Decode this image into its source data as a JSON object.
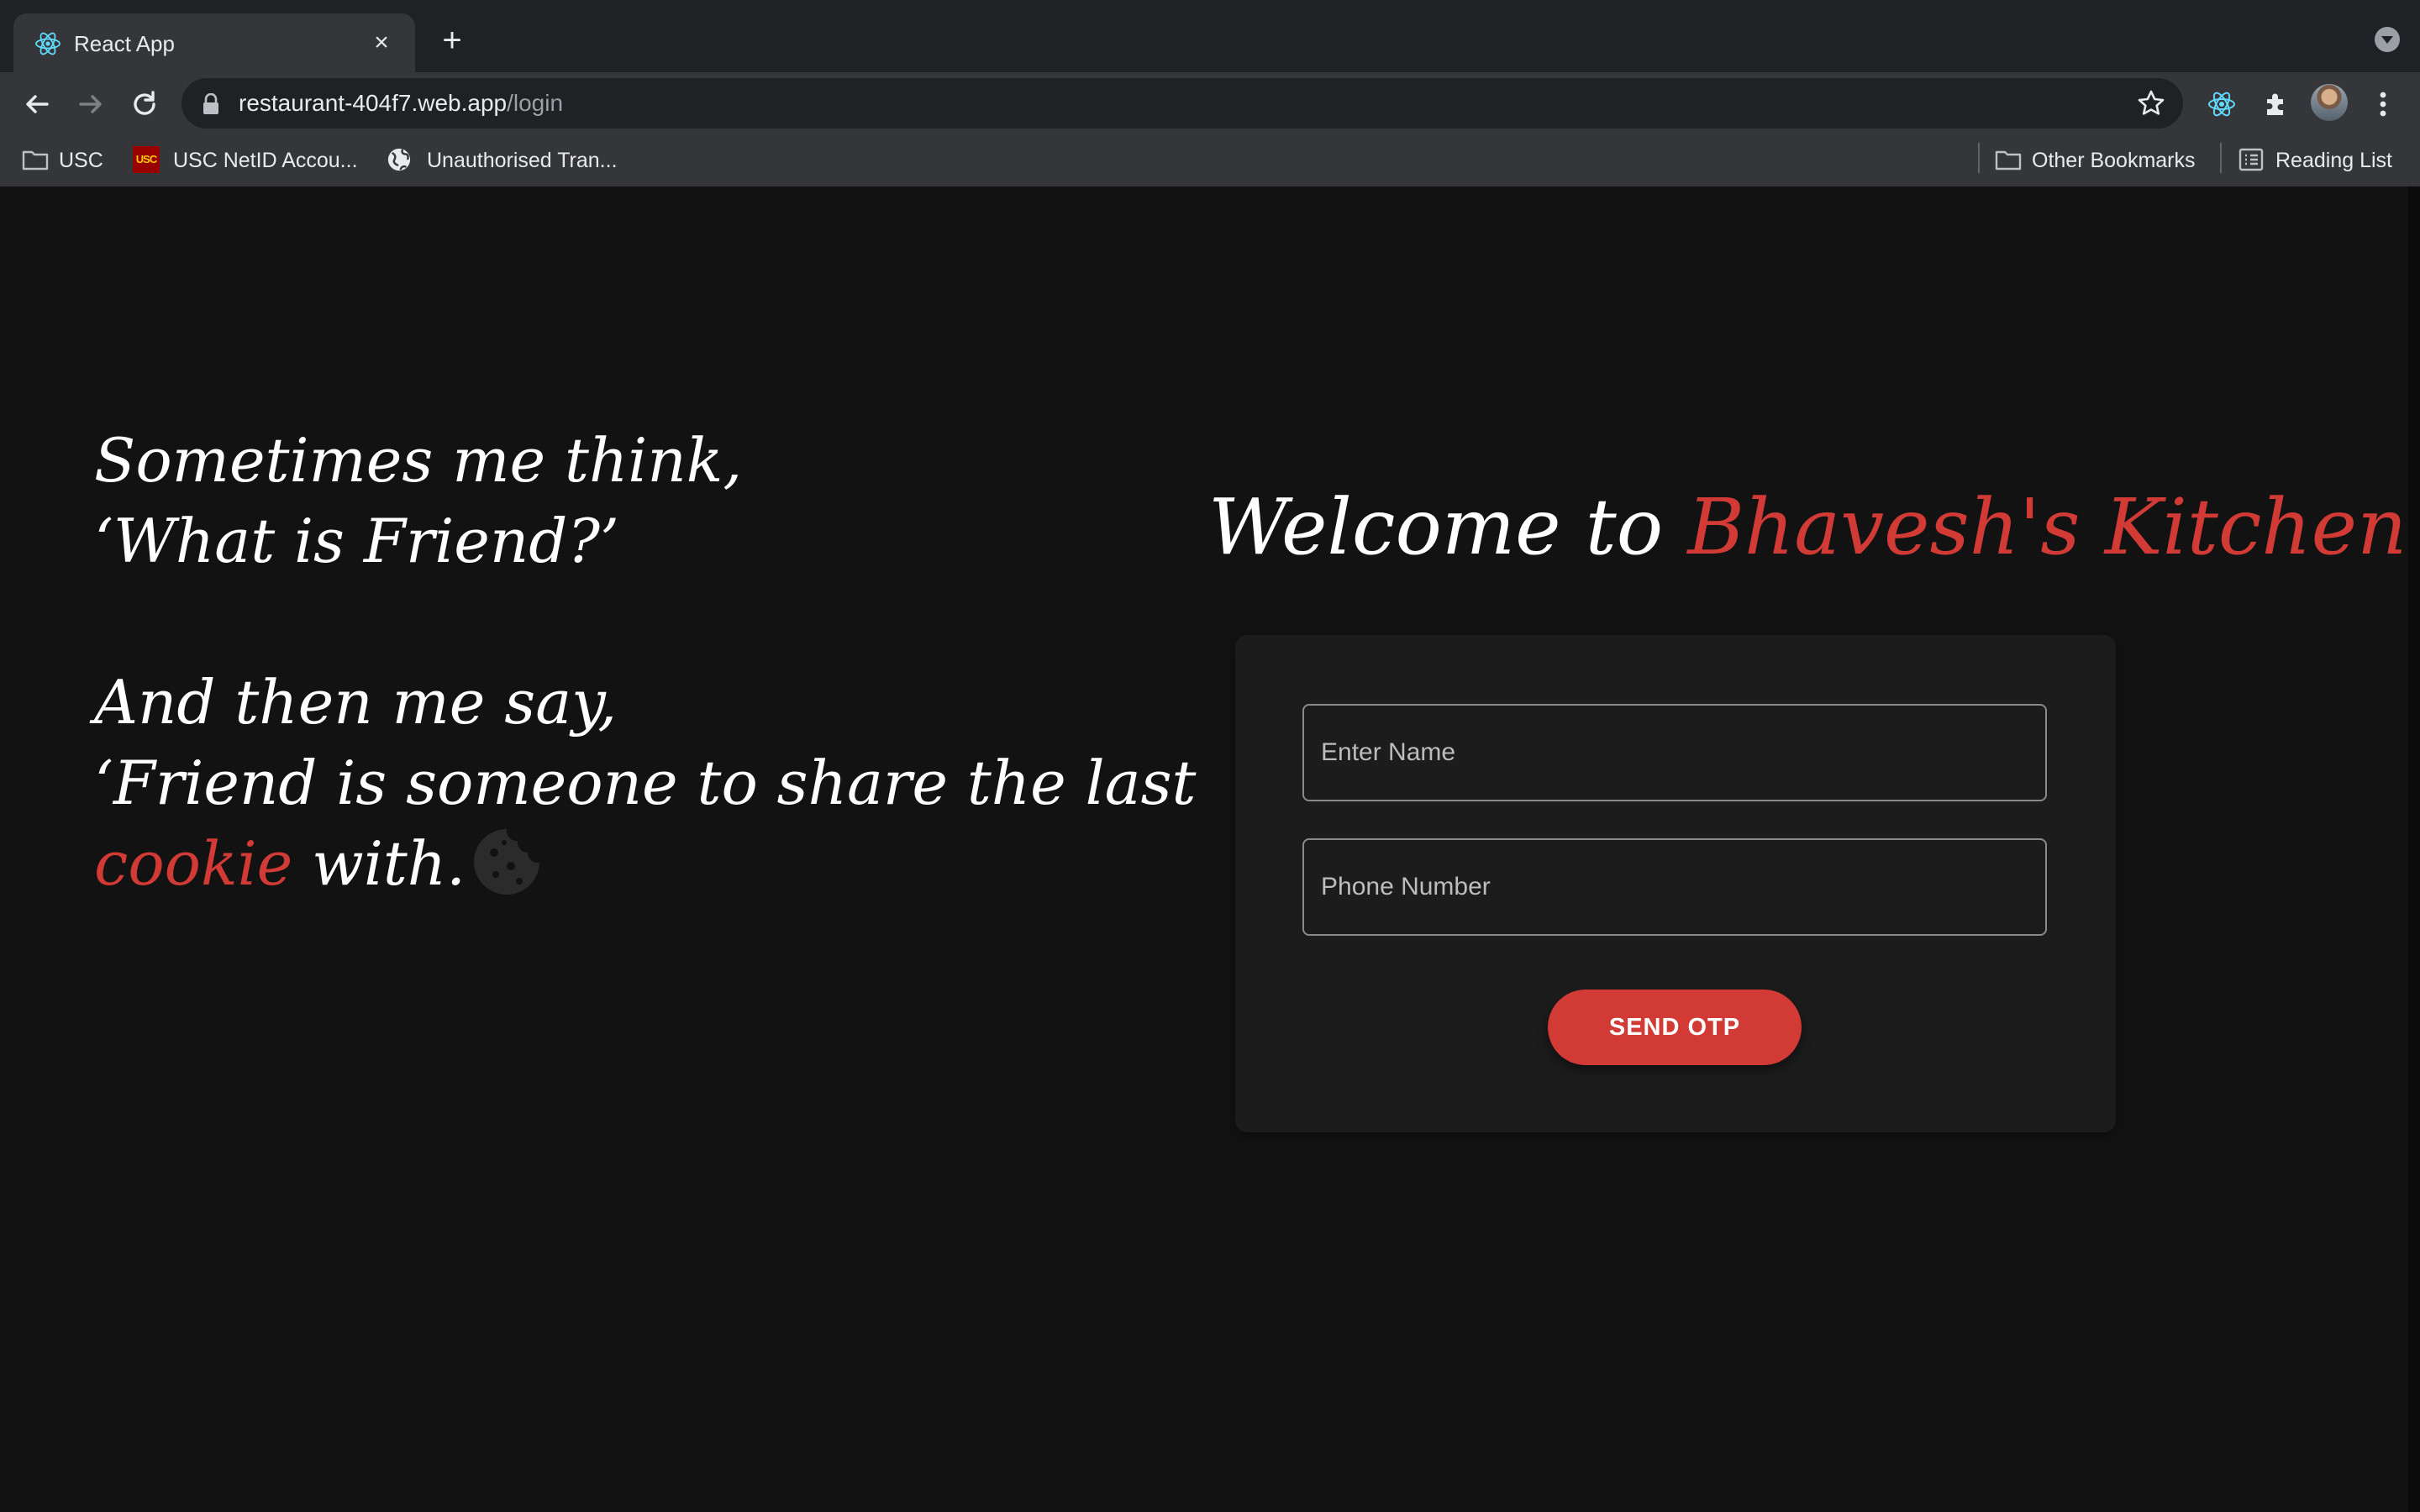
{
  "browser": {
    "tab_title": "React App",
    "tab_close_glyph": "×",
    "new_tab_glyph": "+",
    "url_host": "restaurant-404f7.web.app",
    "url_path": "/login",
    "bookmarks": [
      {
        "label": "USC",
        "icon": "folder-icon"
      },
      {
        "label": "USC NetID Accou...",
        "icon": "usc-logo-icon",
        "badge": "USC"
      },
      {
        "label": "Unauthorised Tran...",
        "icon": "globe-icon"
      }
    ],
    "bookmarks_right": [
      {
        "label": "Other Bookmarks",
        "icon": "folder-icon"
      },
      {
        "label": "Reading List",
        "icon": "reading-list-icon"
      }
    ]
  },
  "quote": {
    "line1": "Sometimes me think,",
    "line2": "‘What is Friend?’",
    "line3": "And then me say,",
    "line4": "‘Friend is someone to share the last",
    "line5_highlight": "cookie",
    "line5_rest": " with."
  },
  "login": {
    "welcome_prefix": "Welcome to ",
    "welcome_brand": "Bhavesh's Kitchen",
    "name_placeholder": "Enter Name",
    "phone_placeholder": "Phone Number",
    "submit_label": "SEND OTP"
  },
  "colors": {
    "accent": "#d23b35",
    "background": "#121212",
    "card": "#1c1c1c"
  }
}
